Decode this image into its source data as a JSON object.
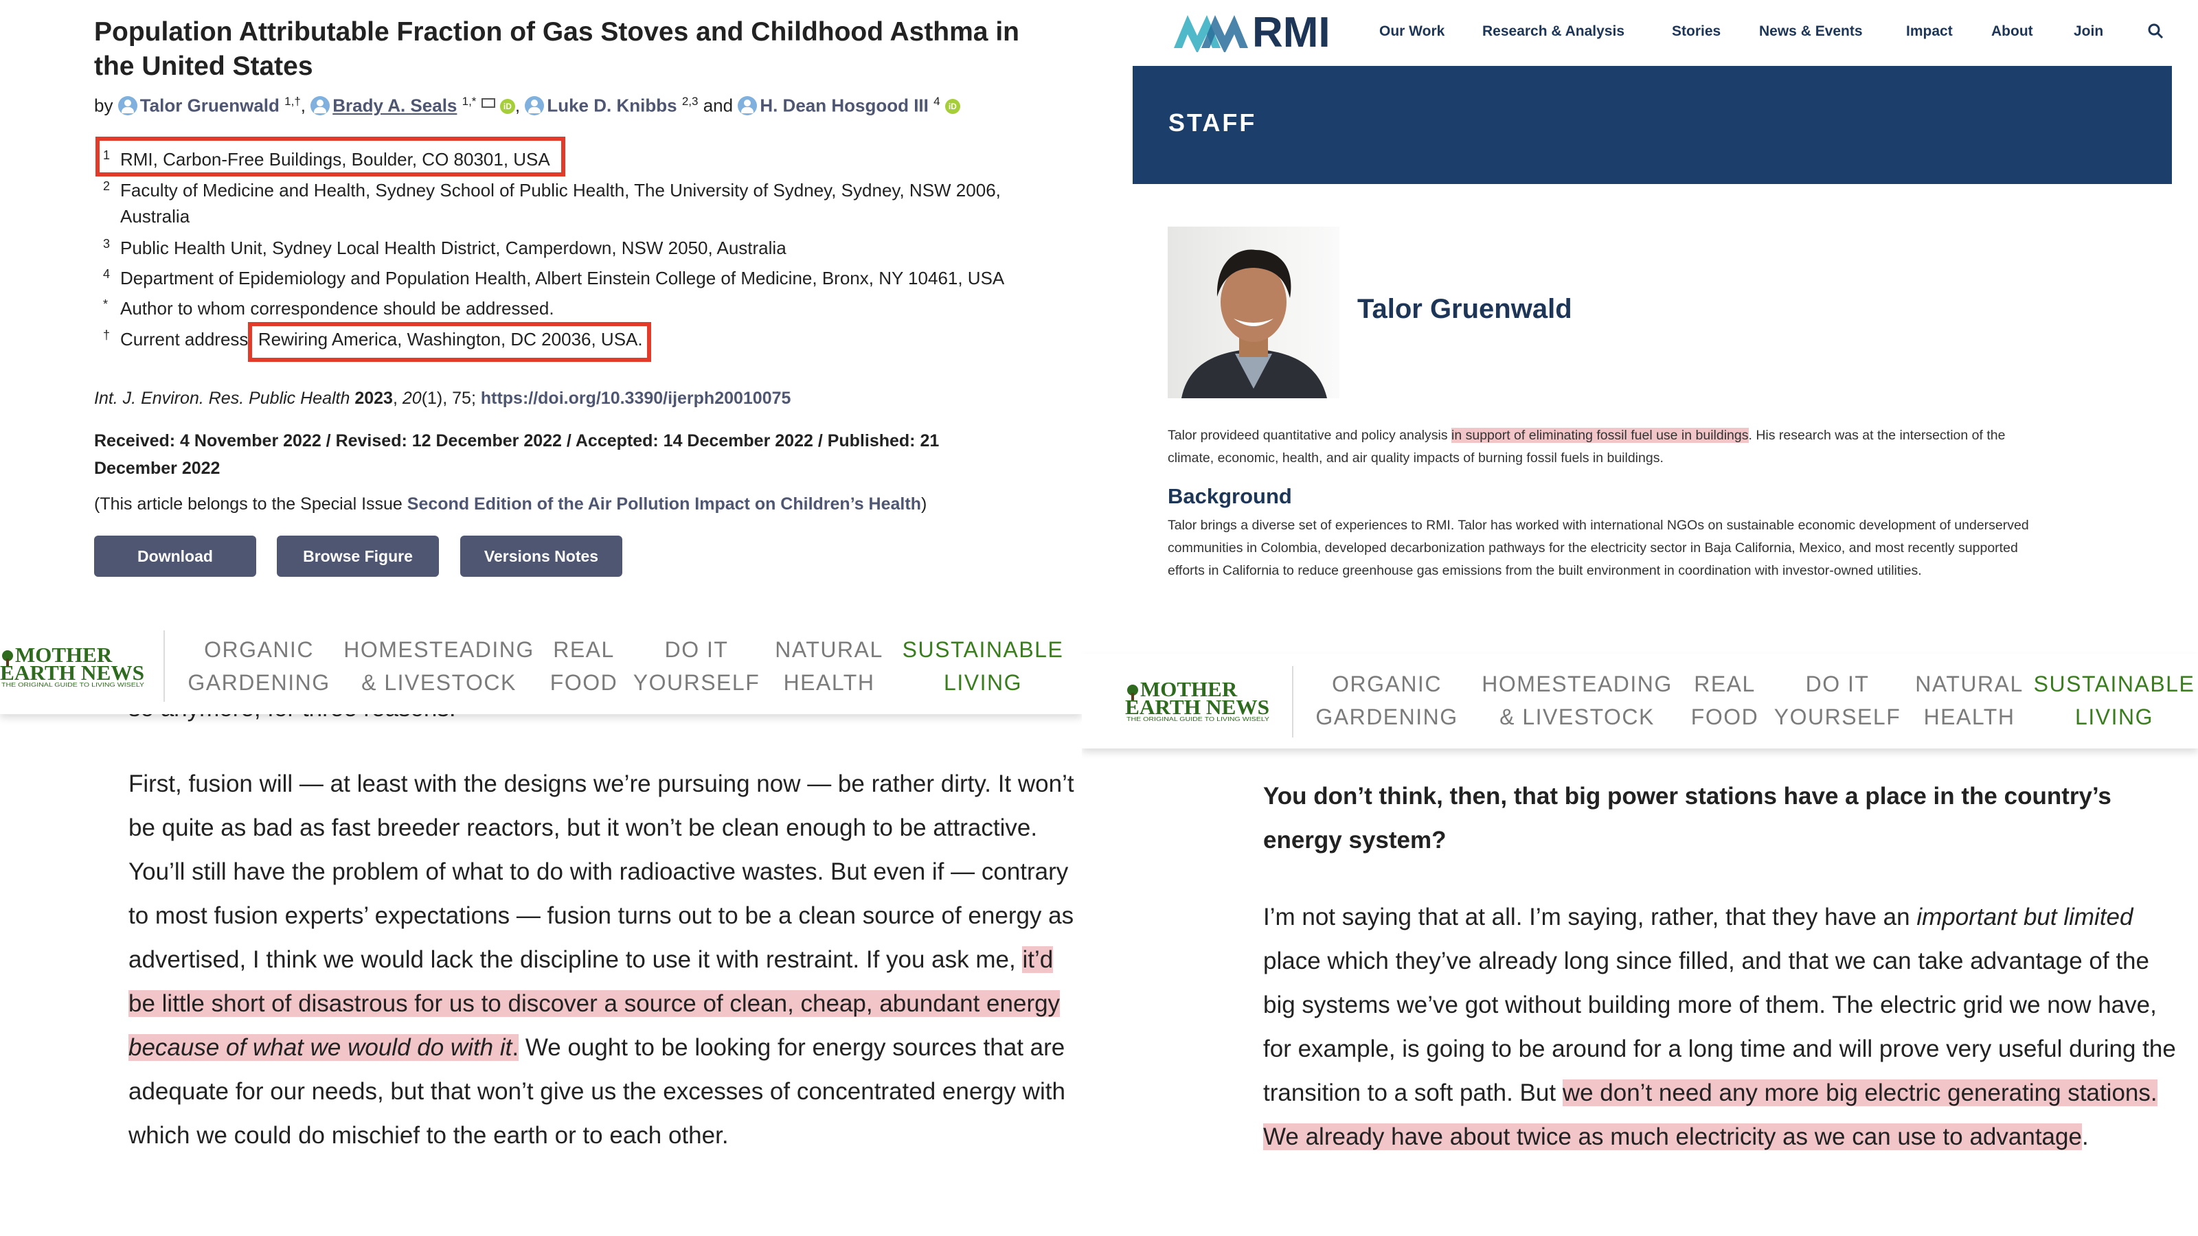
{
  "paper": {
    "title": "Population Attributable Fraction of Gas Stoves and Childhood Asthma in the United States",
    "by": "by",
    "authors": [
      {
        "name": "Talor Gruenwald",
        "sup": "1,†"
      },
      {
        "name": "Brady A. Seals",
        "sup": "1,*"
      },
      {
        "name": "Luke D. Knibbs",
        "sup": "2,3"
      },
      {
        "name": "H. Dean Hosgood III",
        "sup": "4"
      }
    ],
    "and": "and",
    "affiliations": [
      {
        "mark": "1",
        "text": "RMI, Carbon-Free Buildings, Boulder, CO 80301, USA"
      },
      {
        "mark": "2",
        "text": "Faculty of Medicine and Health, Sydney School of Public Health, The University of Sydney, Sydney, NSW 2006, Australia"
      },
      {
        "mark": "3",
        "text": "Public Health Unit, Sydney Local Health District, Camperdown, NSW 2050, Australia"
      },
      {
        "mark": "4",
        "text": "Department of Epidemiology and Population Health, Albert Einstein College of Medicine, Bronx, NY 10461, USA"
      },
      {
        "mark": "*",
        "text": "Author to whom correspondence should be addressed."
      },
      {
        "mark": "†",
        "label": "Current address:",
        "text": "Rewiring America, Washington, DC 20036, USA."
      }
    ],
    "citation": {
      "journal": "Int. J. Environ. Res. Public Health",
      "year": "2023",
      "volume": "20",
      "rest": "(1), 75;",
      "doi": "https://doi.org/10.3390/ijerph20010075"
    },
    "dates": "Received: 4 November 2022 / Revised: 12 December 2022 / Accepted: 14 December 2022 / Published: 21 December 2022",
    "special_prefix": "(This article belongs to the Special Issue",
    "special_issue": "Second Edition of the Air Pollution Impact on Children’s Health",
    "special_suffix": ")",
    "buttons": [
      "Download",
      "Browse Figure",
      "Versions Notes"
    ],
    "accent_color": "#4f5671",
    "box_color": "#e23b2a"
  },
  "rmi": {
    "logo_text": "RMI",
    "nav": [
      "Our Work",
      "Research & Analysis",
      "Stories",
      "News & Events",
      "Impact",
      "About",
      "Join"
    ],
    "search_icon": "search-icon",
    "band_title": "STAFF",
    "name": "Talor Gruenwald",
    "bio_before": "Talor provideed quantitative and policy analysis ",
    "bio_highlight": "in support of eliminating fossil fuel use in buildings",
    "bio_after": ". His research was at the intersection of the climate, economic, health, and air quality impacts of burning fossil fuels in buildings.",
    "background_heading": "Background",
    "background_text": "Talor brings a diverse set of experiences to RMI. Talor has worked with international NGOs on sustainable economic development of underserved communities in Colombia, developed decarbonization pathways for the electricity sector in Baja California, Mexico, and most recently supported efforts in California to reduce greenhouse gas emissions from the built environment in coordination with investor-owned utilities.",
    "brand_color": "#1b3f6a"
  },
  "men": {
    "logo_line1": "MOTHER",
    "logo_line2": "EARTH NEWS",
    "logo_tagline": "THE ORIGINAL GUIDE TO LIVING WISELY",
    "nav": [
      {
        "l1": "ORGANIC",
        "l2": "GARDENING"
      },
      {
        "l1": "HOMESTEADING",
        "l2": "& LIVESTOCK"
      },
      {
        "l1": "REAL",
        "l2": "FOOD"
      },
      {
        "l1": "DO IT",
        "l2": "YOURSELF"
      },
      {
        "l1": "NATURAL",
        "l2": "HEALTH"
      },
      {
        "l1": "SUSTAINABLE",
        "l2": "LIVING"
      }
    ],
    "left_cutoff": "so anymore, for three reasons:",
    "left_p1": "First, fusion will — at least with the designs we’re pursuing now — be rather dirty. It won’t be quite as bad as fast breeder reactors, but it won’t be clean enough to be attractive. You’ll still have the problem of what to do with radioactive wastes. But even if — contrary to most fusion experts’ expectations — fusion turns out to be a clean source of energy as advertised, I think we would lack the discipline to use it with restraint. If you ask me, ",
    "left_hl1": "it’d be little short of disastrous for us to discover a source of clean, cheap, abundant energy ",
    "left_hl_italic": "because of what we would do with it",
    "left_hl2": ".",
    "left_p1_end": " We ought to be looking for energy sources that are adequate for our needs, but that won’t give us the excesses of concentrated energy with which we could do mischief to the earth or to each other.",
    "right_question": "You don’t think, then, that big power stations have a place in the country’s energy system?",
    "right_a1": "I’m not saying that at all. I’m saying, rather, that they have an ",
    "right_a_italic": "important but limited",
    "right_a2": " place which they’ve already long since filled, and that we can take advantage of the big systems we’ve got without building more of them. The electric grid we now have, for example, is going to be around for a long time and will prove very useful during the transition to a soft path. But ",
    "right_hl": "we don’t need any more big electric generating stations. We already have about twice as much electricity as we can use to advantage",
    "right_end": ".",
    "highlight_color": "#f2c6c8",
    "green": "#3a7d1e"
  }
}
